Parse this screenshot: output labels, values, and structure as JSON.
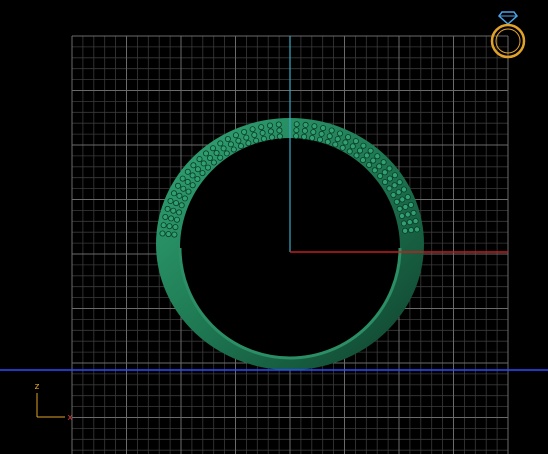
{
  "viewport": {
    "background": "#000000",
    "grid_color": "#6a6a6a",
    "minor_grid_color": "#3a3a3a",
    "ring_color": "#1f7a55",
    "axes": {
      "x_color": "#c21e1e",
      "y_color": "#39a9c4",
      "ground_color": "#2a4cff"
    }
  },
  "gizmo": {
    "vertical_label": "z",
    "horizontal_label": "x",
    "vertical_color": "#e0a22a",
    "horizontal_color": "#d43a3a"
  },
  "view_icon": {
    "name": "ring-view-icon",
    "color": "#e0a22a",
    "gem_color": "#4aa3e8"
  }
}
